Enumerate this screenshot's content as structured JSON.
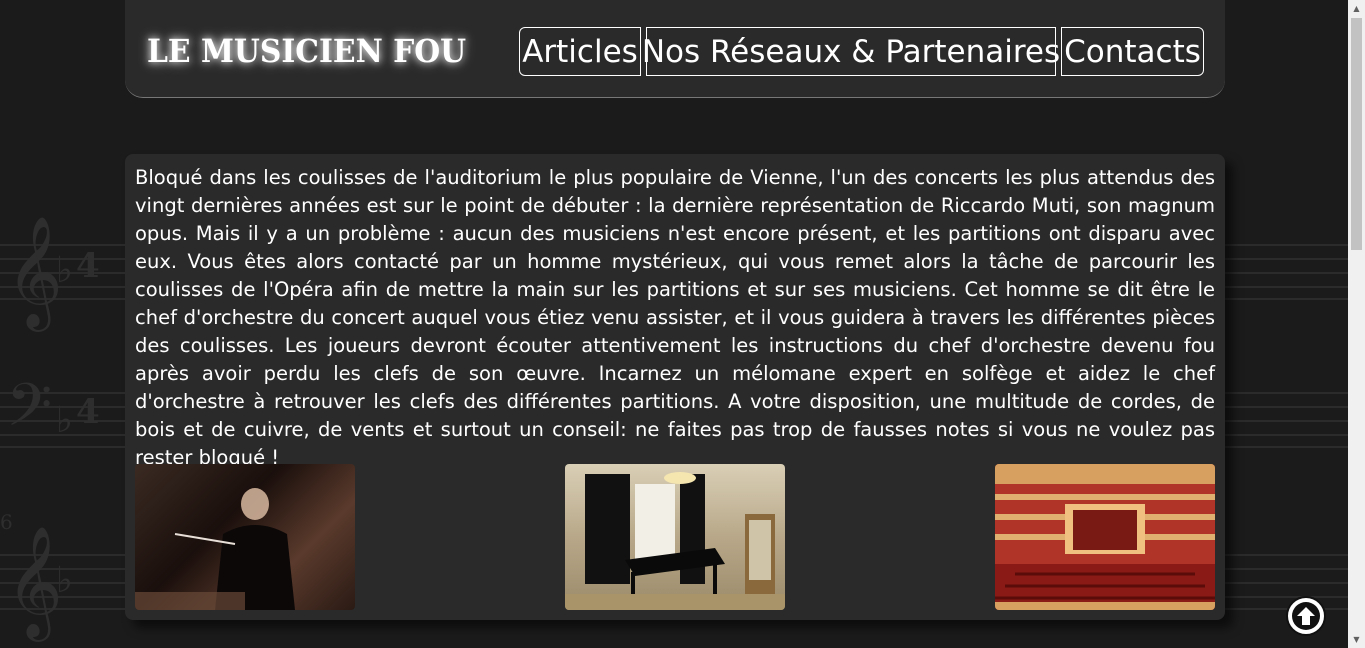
{
  "header": {
    "logo": "LE MUSICIEN FOU",
    "nav": {
      "articles": "Articles",
      "reseaux": "Nos Réseaux & Partenaires",
      "contacts": "Contacts"
    }
  },
  "main": {
    "intro": "Bloqué dans les coulisses de l'auditorium le plus populaire de Vienne, l'un des concerts les plus attendus des vingt dernières années est sur le point de débuter : la dernière représentation de Riccardo Muti, son magnum opus. Mais il y a un problème : aucun des musiciens n'est encore présent, et les partitions ont disparu avec eux. Vous êtes alors contacté par un homme mystérieux, qui vous remet alors la tâche de parcourir les coulisses de l'Opéra afin de mettre la main sur les partitions et sur ses musiciens. Cet homme se dit être le chef d'orchestre du concert auquel vous étiez venu assister, et il vous guidera à travers les différentes pièces des coulisses. Les joueurs devront écouter attentivement les instructions du chef d'orchestre devenu fou après avoir perdu les clefs de son œuvre. Incarnez un mélomane expert en solfège et aidez le chef d'orchestre à retrouver les clefs des différentes partitions. A votre disposition, une multitude de cordes, de bois et de cuivre, de vents et surtout un conseil: ne faites pas trop de fausses notes si vous ne voulez pas rester bloqué !"
  },
  "icons": {
    "scroll_top": "arrow-up-circle-icon",
    "treble_clef": "𝄞",
    "bass_clef": "𝄢",
    "flat": "♭",
    "time_sig": "4",
    "measure_number": "6"
  },
  "colors": {
    "background": "#1b1b1b",
    "panel": "#2a2a2a",
    "text": "#ffffff"
  }
}
